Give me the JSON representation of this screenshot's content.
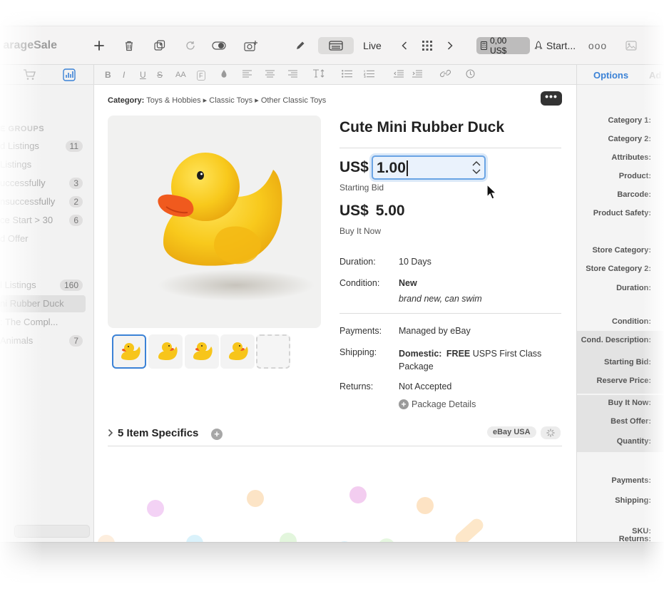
{
  "app": {
    "title": "arageSale"
  },
  "toolbar": {
    "live_label": "Live",
    "price_badge": "0,00 US$",
    "start_label": "Start...",
    "more_label": "ooo",
    "icons": [
      "plus-icon",
      "trash-icon",
      "duplicate-icon",
      "refresh-icon",
      "toggle-icon",
      "add-photo-icon",
      "pencil-icon",
      "layout-icon",
      "chevron-left-icon",
      "grid-icon",
      "chevron-right-icon",
      "calculator-icon",
      "rocket-icon",
      "image-icon"
    ]
  },
  "format_bar": {
    "bold": "B",
    "italic": "I",
    "underline": "U",
    "strike": "S",
    "font_size": "AA",
    "font_face": "F"
  },
  "sidebar": {
    "section": "E GROUPS",
    "items": [
      {
        "label": "d Listings",
        "count": "11"
      },
      {
        "label": "Listings",
        "count": ""
      },
      {
        "label": "uccessfully",
        "count": "3"
      },
      {
        "label": "nsuccessfully",
        "count": "2"
      },
      {
        "label": "ce Start > 30",
        "count": "6"
      },
      {
        "label": "d Offer",
        "count": ""
      },
      {
        "label": "l Listings",
        "count": "160"
      },
      {
        "label": "ni Rubber Duck",
        "count": ""
      },
      {
        "label": ": The Compl...",
        "count": ""
      },
      {
        "label": "Animals",
        "count": "7"
      }
    ]
  },
  "listing": {
    "category_label": "Category:",
    "category_path": "Toys & Hobbies ▸ Classic Toys ▸ Other Classic Toys",
    "more_button": "•••",
    "title": "Cute Mini Rubber Duck",
    "currency": "US$",
    "starting_bid_value": "1.00",
    "starting_bid_label": "Starting Bid",
    "buy_it_now_value": "5.00",
    "buy_it_now_label": "Buy It Now",
    "duration_label": "Duration:",
    "duration_value": "10 Days",
    "condition_label": "Condition:",
    "condition_value": "New",
    "condition_note": "brand new, can swim",
    "payments_label": "Payments:",
    "payments_value": "Managed by eBay",
    "shipping_label": "Shipping:",
    "shipping_domestic": "Domestic:",
    "shipping_free": "FREE",
    "shipping_service": "USPS First Class Package",
    "returns_label": "Returns:",
    "returns_value": "Not Accepted",
    "package_details": "Package Details",
    "specifics_title": "5 Item Specifics",
    "marketplace": "eBay USA"
  },
  "inspector": {
    "tabs": [
      "Options",
      "Ad"
    ],
    "labels": [
      "Category 1:",
      "Category 2:",
      "Attributes:",
      "Product:",
      "Barcode:",
      "Product Safety:",
      "Store Category:",
      "Store Category 2:",
      "Duration:",
      "Condition:",
      "Cond. Description:",
      "Starting Bid:",
      "Reserve Price:",
      "Buy It Now:",
      "Best Offer:",
      "Quantity:",
      "Payments:",
      "Shipping:",
      "Returns:",
      "SKU:"
    ]
  },
  "colors": {
    "accent": "#3b82d6",
    "duck_yellow": "#f6c21a",
    "beak_orange": "#f05a1e"
  }
}
